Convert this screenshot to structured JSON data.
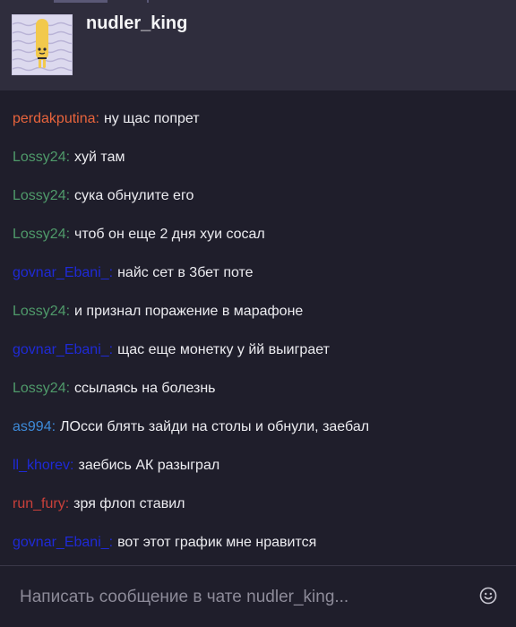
{
  "header": {
    "channel_name": "nudler_king"
  },
  "messages": [
    {
      "user": "perdakputina:",
      "color": "#e8643c",
      "text": "ну щас попрет"
    },
    {
      "user": "Lossy24:",
      "color": "#4f9a6a",
      "text": "хуй там"
    },
    {
      "user": "Lossy24:",
      "color": "#4f9a6a",
      "text": "сука обнулите его"
    },
    {
      "user": "Lossy24:",
      "color": "#4f9a6a",
      "text": "чтоб он еще 2 дня хуи сосал"
    },
    {
      "user": "govnar_Ebani_:",
      "color": "#1f2ad6",
      "text": "найс сет в 3бет поте"
    },
    {
      "user": "Lossy24:",
      "color": "#4f9a6a",
      "text": "и признал поражение в марафоне"
    },
    {
      "user": "govnar_Ebani_:",
      "color": "#1f2ad6",
      "text": "щас еще монетку у йй выиграет"
    },
    {
      "user": "Lossy24:",
      "color": "#4f9a6a",
      "text": "ссылаясь на болезнь"
    },
    {
      "user": "as994:",
      "color": "#3d8ad8",
      "text": "ЛОсси блять зайди на столы и обнули, заебал"
    },
    {
      "user": "ll_khorev:",
      "color": "#1f2ad6",
      "text": "заебись АК разыграл"
    },
    {
      "user": "run_fury:",
      "color": "#c9403a",
      "text": "зря флоп ставил"
    },
    {
      "user": "govnar_Ebani_:",
      "color": "#1f2ad6",
      "text": "вот этот график мне нравится"
    }
  ],
  "input": {
    "placeholder": "Написать сообщение в чате nudler_king..."
  },
  "icons": {
    "avatar": "avatar-mascot-icon",
    "emoji": "emoji-smile-icon"
  }
}
